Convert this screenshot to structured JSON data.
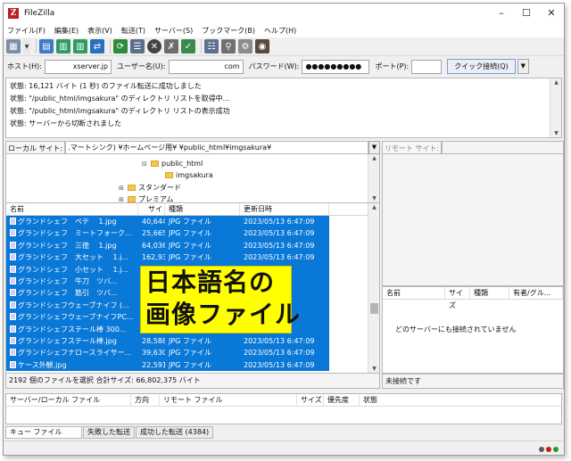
{
  "window": {
    "title": "FileZilla"
  },
  "menu": [
    "ファイル(F)",
    "編集(E)",
    "表示(V)",
    "転送(T)",
    "サーバー(S)",
    "ブックマーク(B)",
    "ヘルプ(H)"
  ],
  "quickconnect": {
    "host_label": "ホスト(H):",
    "host_value": "xserver.jp",
    "user_label": "ユーザー名(U):",
    "user_value": "com",
    "pass_label": "パスワード(W):",
    "pass_value": "●●●●●●●●●",
    "port_label": "ポート(P):",
    "port_value": "",
    "connect_button": "クイック接続(Q)"
  },
  "log": [
    "状態:  16,121 バイト (1 秒) のファイル転送に成功しました",
    "状態:  \"/public_html/imgsakura\" のディレクトリ リストを取得中...",
    "状態:  \"/public_html/imgsakura\" のディレクトリ リストの表示成功",
    "状態:  サーバーから切断されました"
  ],
  "local": {
    "site_label": "ローカル サイト:",
    "site_path": ".マートシンク) ¥ホームページ用¥                          ¥public_html¥imgsakura¥",
    "tree": {
      "parent": "public_html",
      "child": "imgsakura",
      "sibling1": "スタンダード",
      "sibling2": "プレミアム"
    },
    "columns": [
      "名前",
      "サイズ",
      "種類",
      "更新日時"
    ],
    "files": [
      {
        "name": "グランドシェフ　ペテ　 1.jpg",
        "size": "40,644",
        "type": "JPG ファイル",
        "date": "2023/05/13 6:47:09"
      },
      {
        "name": "グランドシェフ　ミートフォーク...",
        "size": "25,665",
        "type": "JPG ファイル",
        "date": "2023/05/13 6:47:09"
      },
      {
        "name": "グランドシェフ　三徳　 1.jpg",
        "size": "64,036",
        "type": "JPG ファイル",
        "date": "2023/05/13 6:47:09"
      },
      {
        "name": "グランドシェフ　大セット　 1.j...",
        "size": "162,933",
        "type": "JPG ファイル",
        "date": "2023/05/13 6:47:09"
      },
      {
        "name": "グランドシェフ　小セット　 1.j...",
        "size": "148",
        "type": "",
        "date": ""
      },
      {
        "name": "グランドシェフ　牛刀　ツバ...",
        "size": "25",
        "type": "",
        "date": ""
      },
      {
        "name": "グランドシェフ　筋引　ツバ...",
        "size": "25",
        "type": "",
        "date": ""
      },
      {
        "name": "グランドシェフウェーブナイフ (...",
        "size": "49",
        "type": "",
        "date": ""
      },
      {
        "name": "グランドシェフウェーブナイフPC...",
        "size": "",
        "type": "",
        "date": ""
      },
      {
        "name": "グランドシェフステール棒 300...",
        "size": "27",
        "type": "",
        "date": ""
      },
      {
        "name": "グランドシェフステール棒.jpg",
        "size": "28,588",
        "type": "JPG ファイル",
        "date": "2023/05/13 6:47:09"
      },
      {
        "name": "グランドシェフナロースライサー...",
        "size": "39,630",
        "type": "JPG ファイル",
        "date": "2023/05/13 6:47:09"
      },
      {
        "name": "ケース外観.jpg",
        "size": "22,591",
        "type": "JPG ファイル",
        "date": "2023/05/13 6:47:09"
      }
    ],
    "status": "2192 個のファイルを選択 合計サイズ: 66,802,375 バイト"
  },
  "remote": {
    "site_label": "リモート サイト:",
    "columns": [
      "名前",
      "サイズ",
      "種類",
      "有者/グル..."
    ],
    "empty_message": "どのサーバーにも接続されていません",
    "status": "未接続です"
  },
  "queue": {
    "columns": [
      "サーバー/ローカル ファイル",
      "方向",
      "リモート ファイル",
      "サイズ",
      "優先度",
      "状態"
    ],
    "tabs": [
      "キュー ファイル",
      "失敗した転送",
      "成功した転送 (4384)"
    ]
  },
  "callout": {
    "line1": "日本語名の",
    "line2": "画像ファイル"
  },
  "colors": {
    "selection": "#0a78d7",
    "callout": "#ffff00"
  }
}
